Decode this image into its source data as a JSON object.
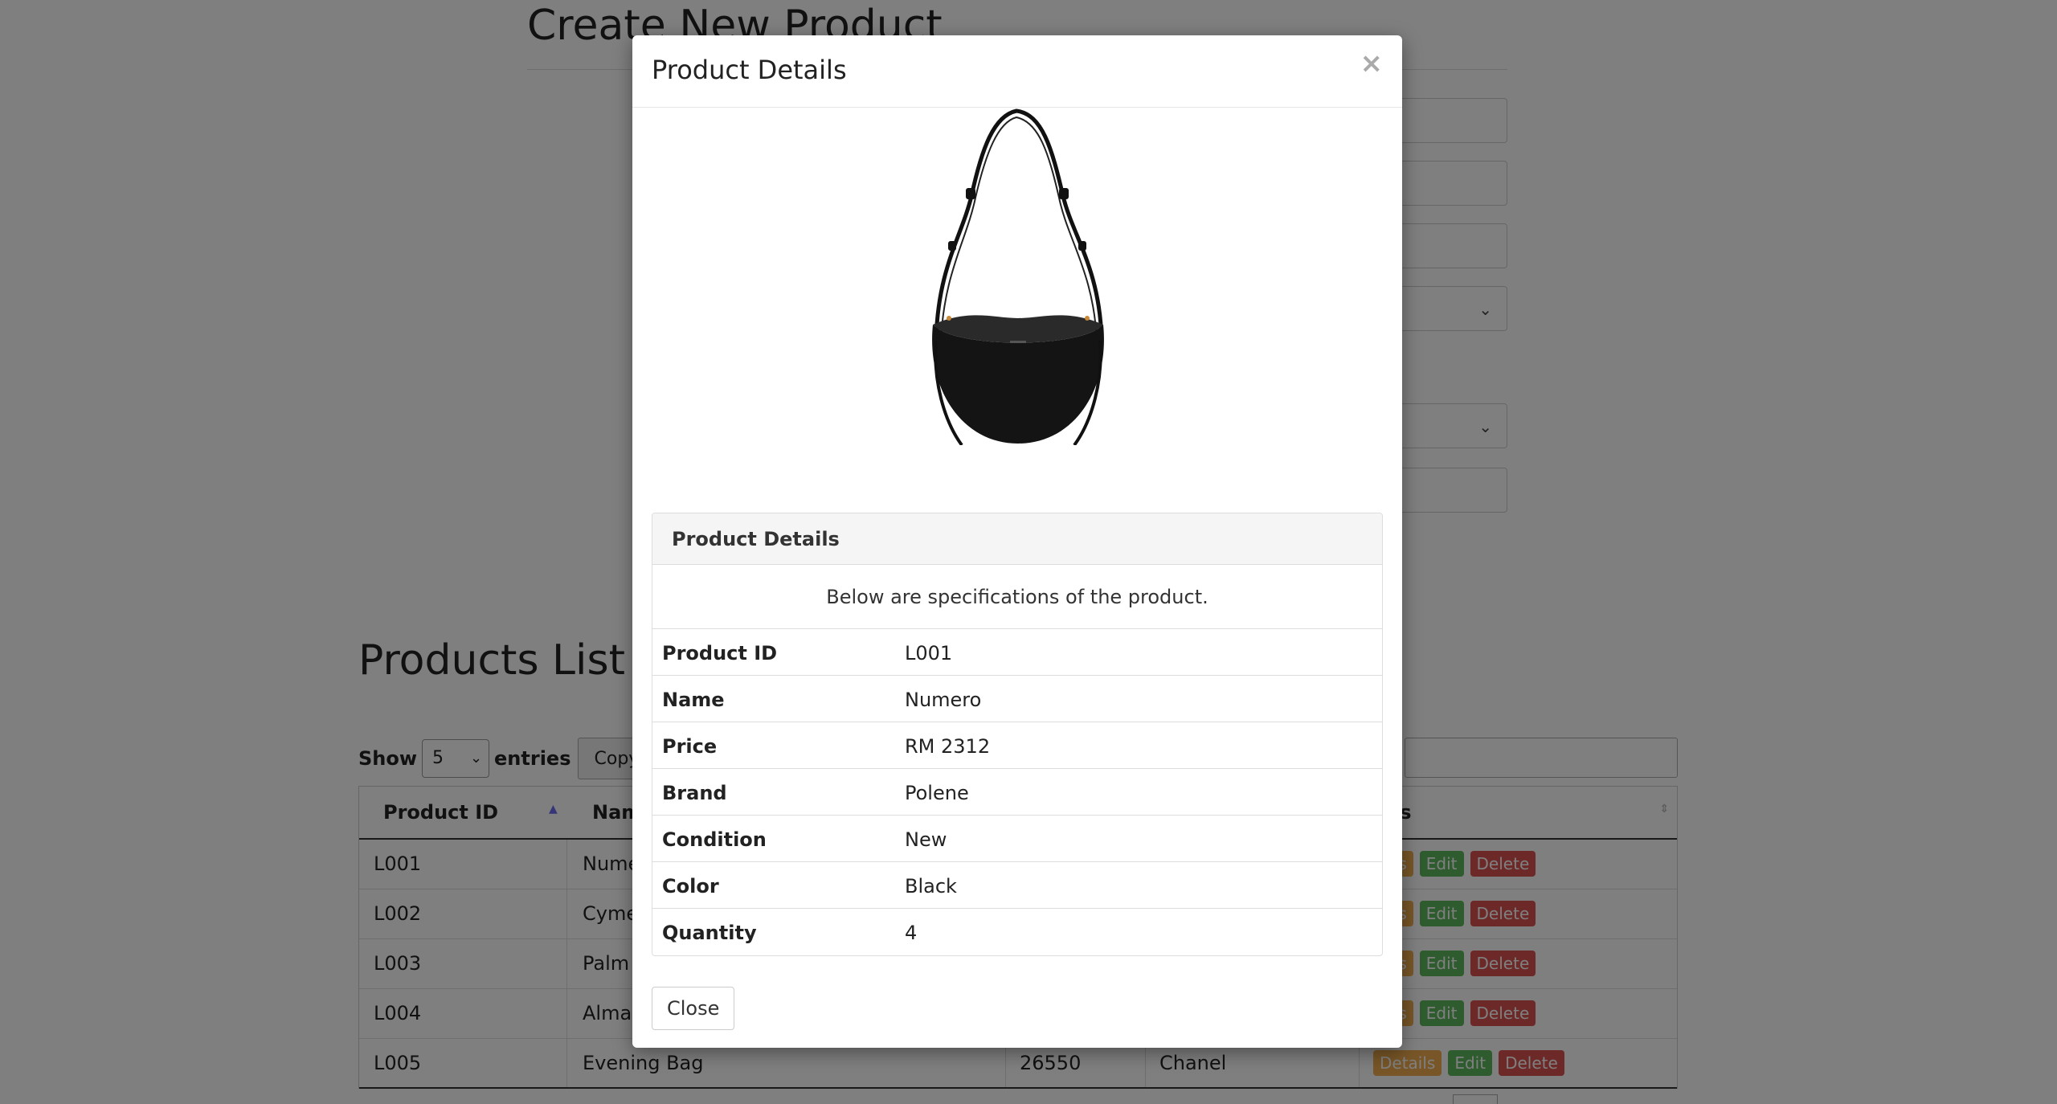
{
  "page": {
    "create_title": "Create New Product",
    "list_title": "Products List",
    "controls": {
      "show_label": "Show",
      "entries_value": "5",
      "entries_label": "entries",
      "copy_label": "Copy"
    },
    "table": {
      "headers": {
        "id": "Product ID",
        "name": "Nam",
        "actions": "tions"
      },
      "rows": [
        {
          "id": "L001",
          "name": "Nume",
          "price": "",
          "brand": ""
        },
        {
          "id": "L002",
          "name": "Cyme",
          "price": "",
          "brand": ""
        },
        {
          "id": "L003",
          "name": "Palm",
          "price": "",
          "brand": ""
        },
        {
          "id": "L004",
          "name": "Alma",
          "price": "",
          "brand": ""
        },
        {
          "id": "L005",
          "name": "Evening Bag",
          "price": "26550",
          "brand": "Chanel"
        }
      ],
      "action_labels": {
        "details_partial": "ails",
        "details": "Details",
        "edit": "Edit",
        "delete": "Delete"
      }
    }
  },
  "modal": {
    "title": "Product Details",
    "close_x": "×",
    "panel": {
      "heading": "Product Details",
      "intro": "Below are specifications of the product.",
      "specs": [
        {
          "label": "Product ID",
          "value": "L001"
        },
        {
          "label": "Name",
          "value": "Numero"
        },
        {
          "label": "Price",
          "value": "RM 2312"
        },
        {
          "label": "Brand",
          "value": "Polene"
        },
        {
          "label": "Condition",
          "value": "New"
        },
        {
          "label": "Color",
          "value": "Black"
        },
        {
          "label": "Quantity",
          "value": "4"
        }
      ]
    },
    "close_button": "Close"
  },
  "colors": {
    "details": "#f0ad4e",
    "edit": "#5cb85c",
    "delete": "#d9534f",
    "backdrop": "rgba(0,0,0,0.5)"
  }
}
